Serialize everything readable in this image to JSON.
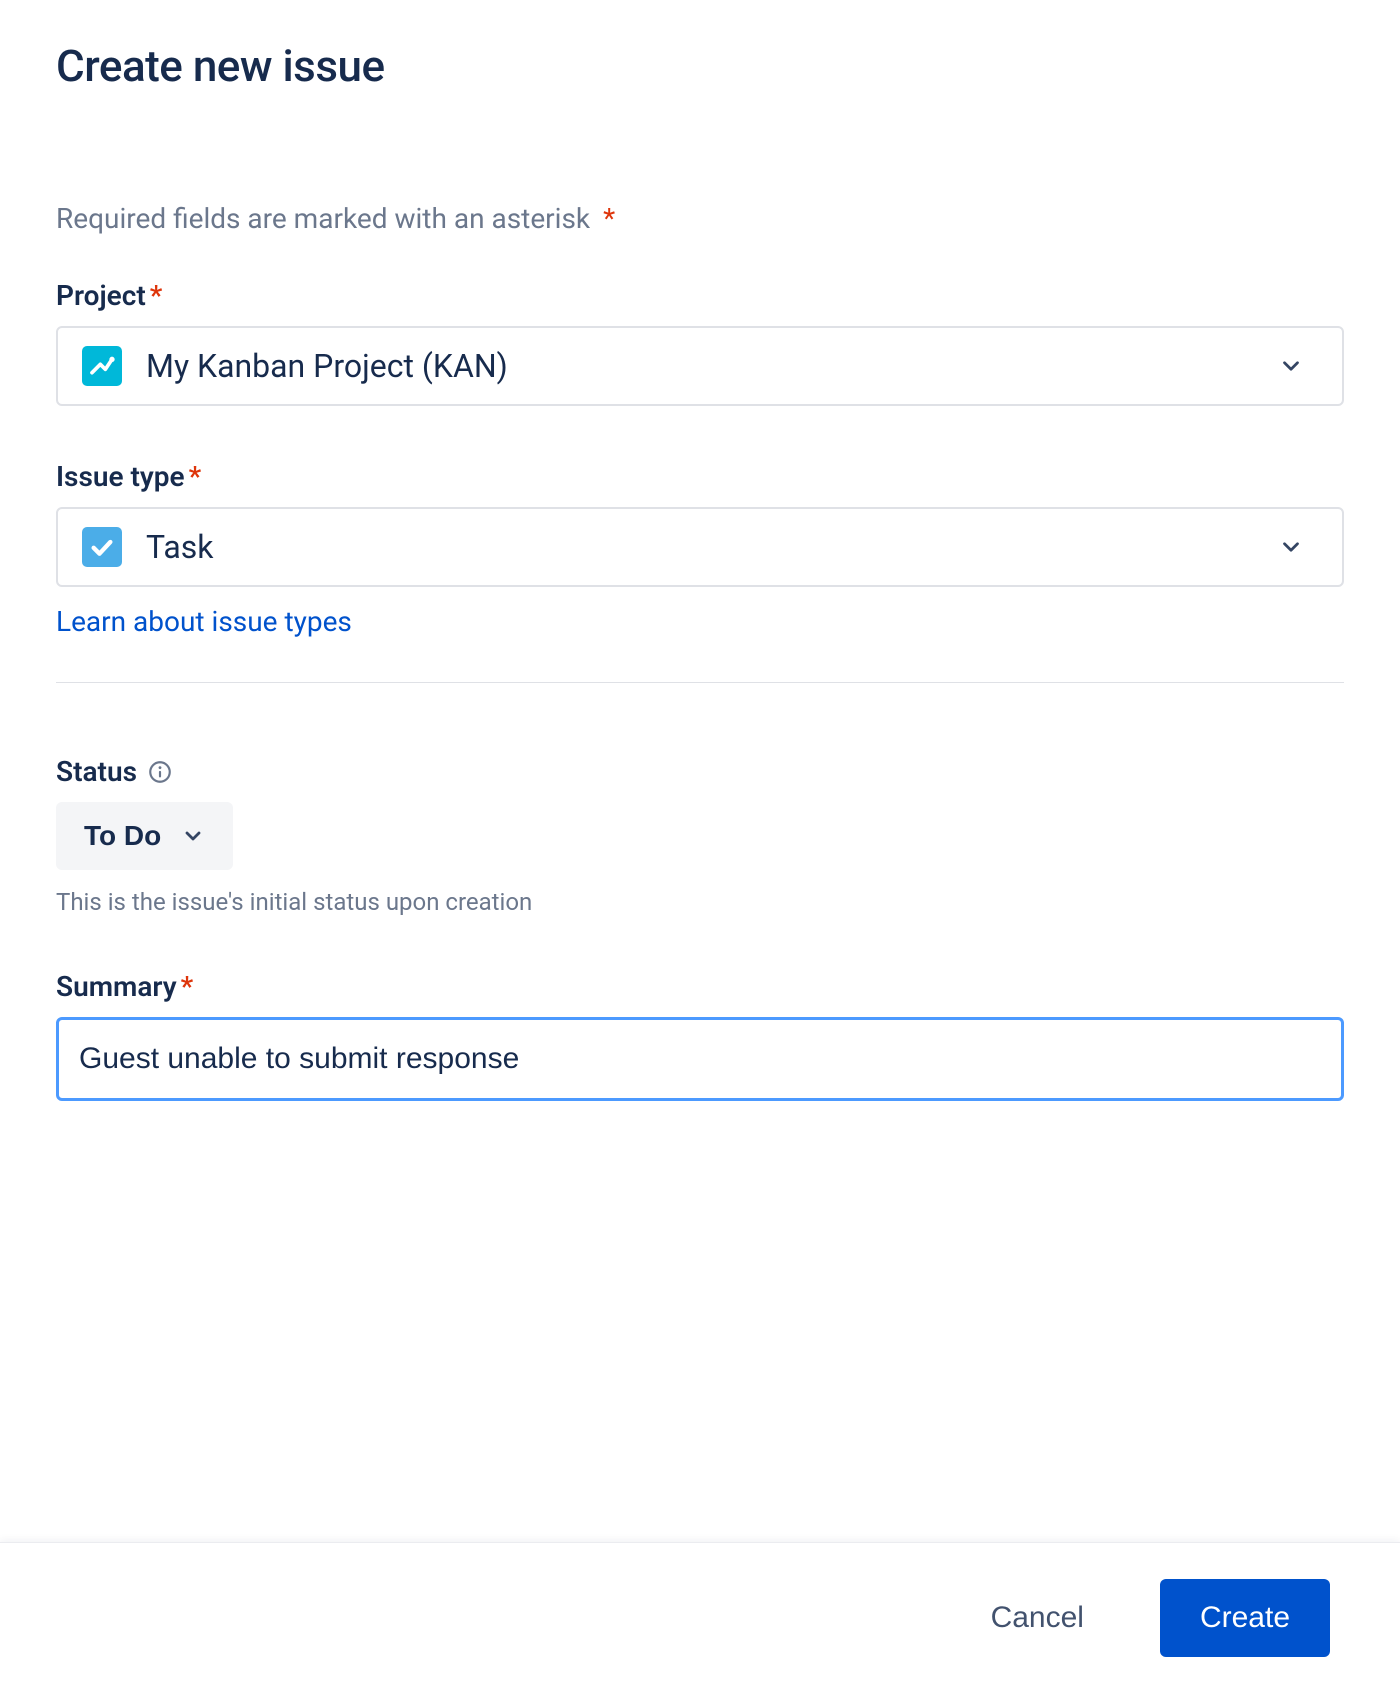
{
  "dialog": {
    "title": "Create new issue",
    "requiredNote": "Required fields are marked with an asterisk"
  },
  "fields": {
    "project": {
      "label": "Project",
      "value": "My Kanban Project (KAN)"
    },
    "issueType": {
      "label": "Issue type",
      "value": "Task",
      "helpLink": "Learn about issue types"
    },
    "status": {
      "label": "Status",
      "value": "To Do",
      "helper": "This is the issue's initial status upon creation"
    },
    "summary": {
      "label": "Summary",
      "value": "Guest unable to submit response"
    }
  },
  "footer": {
    "cancel": "Cancel",
    "create": "Create"
  }
}
